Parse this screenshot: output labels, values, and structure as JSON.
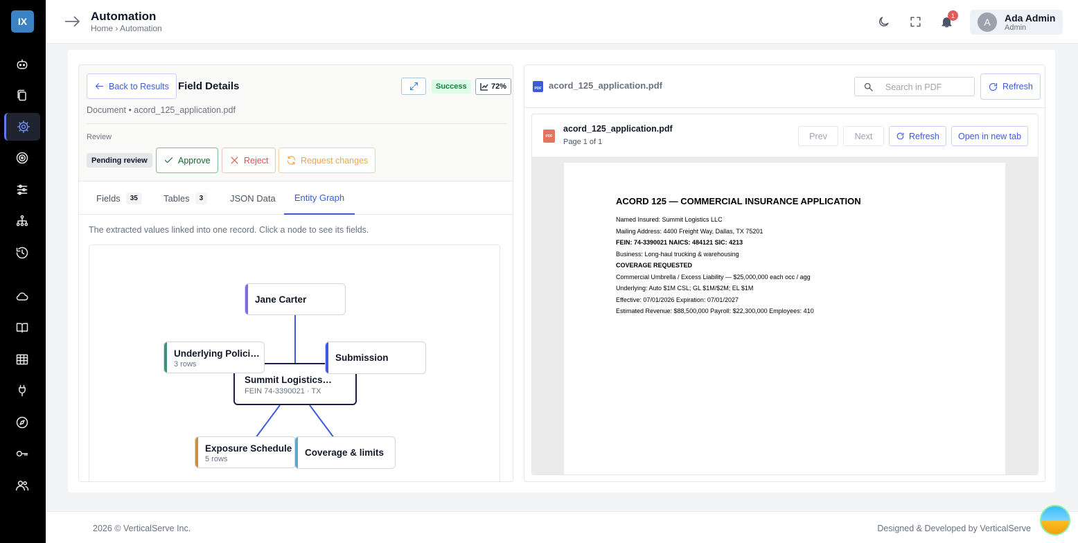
{
  "sidebar": {
    "logo": "IX",
    "items": [
      {
        "icon": "robot-icon"
      },
      {
        "icon": "documents-icon"
      },
      {
        "icon": "gear-icon",
        "active": true
      },
      {
        "icon": "target-icon"
      },
      {
        "icon": "sliders-icon"
      },
      {
        "icon": "hierarchy-icon"
      },
      {
        "icon": "history-icon"
      },
      {
        "icon": "cloud-icon"
      },
      {
        "icon": "book-icon"
      },
      {
        "icon": "table-icon"
      },
      {
        "icon": "plug-icon"
      },
      {
        "icon": "compass-icon"
      },
      {
        "icon": "key-icon"
      },
      {
        "icon": "users-icon"
      }
    ]
  },
  "header": {
    "title": "Automation",
    "breadcrumb": "Home › Automation",
    "notification_count": "1",
    "user": {
      "initial": "A",
      "name": "Ada Admin",
      "role": "Admin"
    }
  },
  "details": {
    "back_label": "Back to Results",
    "title": "Field Details",
    "status": "Success",
    "confidence": "72%",
    "document_line": "Document • acord_125_application.pdf",
    "review_label": "Review",
    "review_status": "Pending review",
    "approve_label": "Approve",
    "reject_label": "Reject",
    "request_changes_label": "Request changes"
  },
  "tabs": [
    {
      "label": "Fields",
      "count": "35"
    },
    {
      "label": "Tables",
      "count": "3"
    },
    {
      "label": "JSON Data",
      "count": ""
    },
    {
      "label": "Entity Graph",
      "count": "",
      "active": true
    }
  ],
  "graph": {
    "description": "The extracted values linked into one record. Click a node to see its fields.",
    "nodes": {
      "person": {
        "title": "Jane Carter",
        "accent": "#7c6fe0"
      },
      "policies": {
        "title": "Underlying Polici…",
        "sub": "3 rows",
        "accent": "#3f8f7d"
      },
      "submission": {
        "title": "Submission",
        "accent": "#3b5bdb"
      },
      "center": {
        "title": "Summit Logistics …",
        "sub": "FEIN 74-3390021 · TX"
      },
      "exposure": {
        "title": "Exposure Schedule",
        "sub": "5 rows",
        "accent": "#c99243"
      },
      "coverage": {
        "title": "Coverage & limits",
        "accent": "#5fa6c7"
      }
    }
  },
  "viewer": {
    "filename": "acord_125_application.pdf",
    "search_placeholder": "Search in PDF",
    "refresh_label": "Refresh",
    "page_info": "Page 1 of 1",
    "prev_label": "Prev",
    "next_label": "Next",
    "open_tab_label": "Open in new tab",
    "pdf": {
      "title": "ACORD 125 — COMMERCIAL INSURANCE APPLICATION",
      "lines": [
        {
          "text": "Named Insured: Summit Logistics LLC",
          "bold": false
        },
        {
          "text": "Mailing Address: 4400 Freight Way, Dallas, TX 75201",
          "bold": false
        },
        {
          "text": "FEIN: 74-3390021    NAICS: 484121    SIC: 4213",
          "bold": true
        },
        {
          "text": "Business: Long-haul trucking & warehousing",
          "bold": false
        },
        {
          "text": "COVERAGE REQUESTED",
          "bold": true
        },
        {
          "text": "Commercial Umbrella / Excess Liability — $25,000,000 each occ / agg",
          "bold": false
        },
        {
          "text": "Underlying: Auto $1M CSL; GL $1M/$2M; EL $1M",
          "bold": false
        },
        {
          "text": "Effective: 07/01/2026  Expiration: 07/01/2027",
          "bold": false
        },
        {
          "text": "Estimated Revenue: $88,500,000  Payroll: $22,300,000  Employees: 410",
          "bold": false
        }
      ]
    }
  },
  "footer": {
    "copyright": "2026 © VerticalServe Inc.",
    "credit": "Designed & Developed by VerticalServe"
  }
}
